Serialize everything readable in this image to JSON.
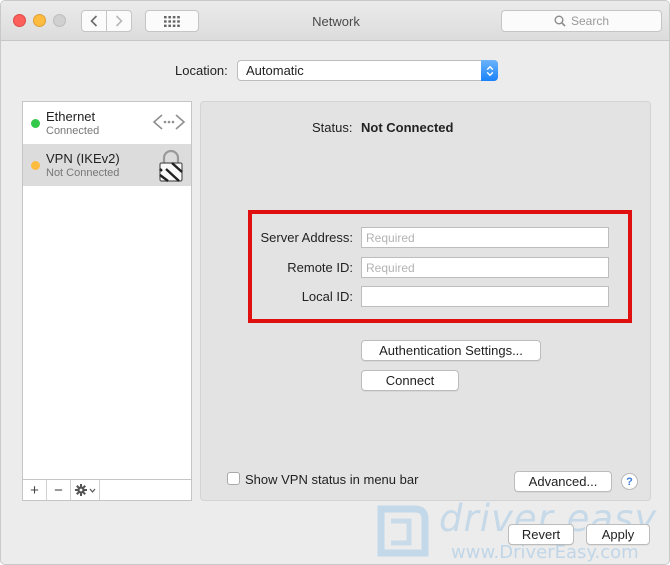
{
  "window": {
    "title": "Network"
  },
  "toolbar": {
    "search_placeholder": "Search"
  },
  "location": {
    "label": "Location:",
    "value": "Automatic"
  },
  "services": [
    {
      "name": "Ethernet",
      "status": "Connected",
      "dot_color": "#34c84a",
      "icon": "ethernet-icon"
    },
    {
      "name": "VPN (IKEv2)",
      "status": "Not Connected",
      "dot_color": "#fdbc40",
      "icon": "lock-icon",
      "selected": true
    }
  ],
  "sidebar_footer": {
    "add": "+",
    "remove": "−"
  },
  "detail": {
    "status_label": "Status:",
    "status_value": "Not Connected",
    "fields": [
      {
        "label": "Server Address:",
        "value": "",
        "placeholder": "Required"
      },
      {
        "label": "Remote ID:",
        "value": "",
        "placeholder": "Required"
      },
      {
        "label": "Local ID:",
        "value": "",
        "placeholder": ""
      }
    ],
    "auth_button": "Authentication Settings...",
    "connect_button": "Connect",
    "show_status_label": "Show VPN status in menu bar",
    "advanced_button": "Advanced...",
    "help": "?"
  },
  "footer": {
    "revert_button": "Revert",
    "apply_button": "Apply"
  },
  "watermark": {
    "brand": "driver easy",
    "url": "www.DriverEasy.com"
  },
  "colors": {
    "highlight": "#e01010",
    "accent": "#1a82fb"
  }
}
